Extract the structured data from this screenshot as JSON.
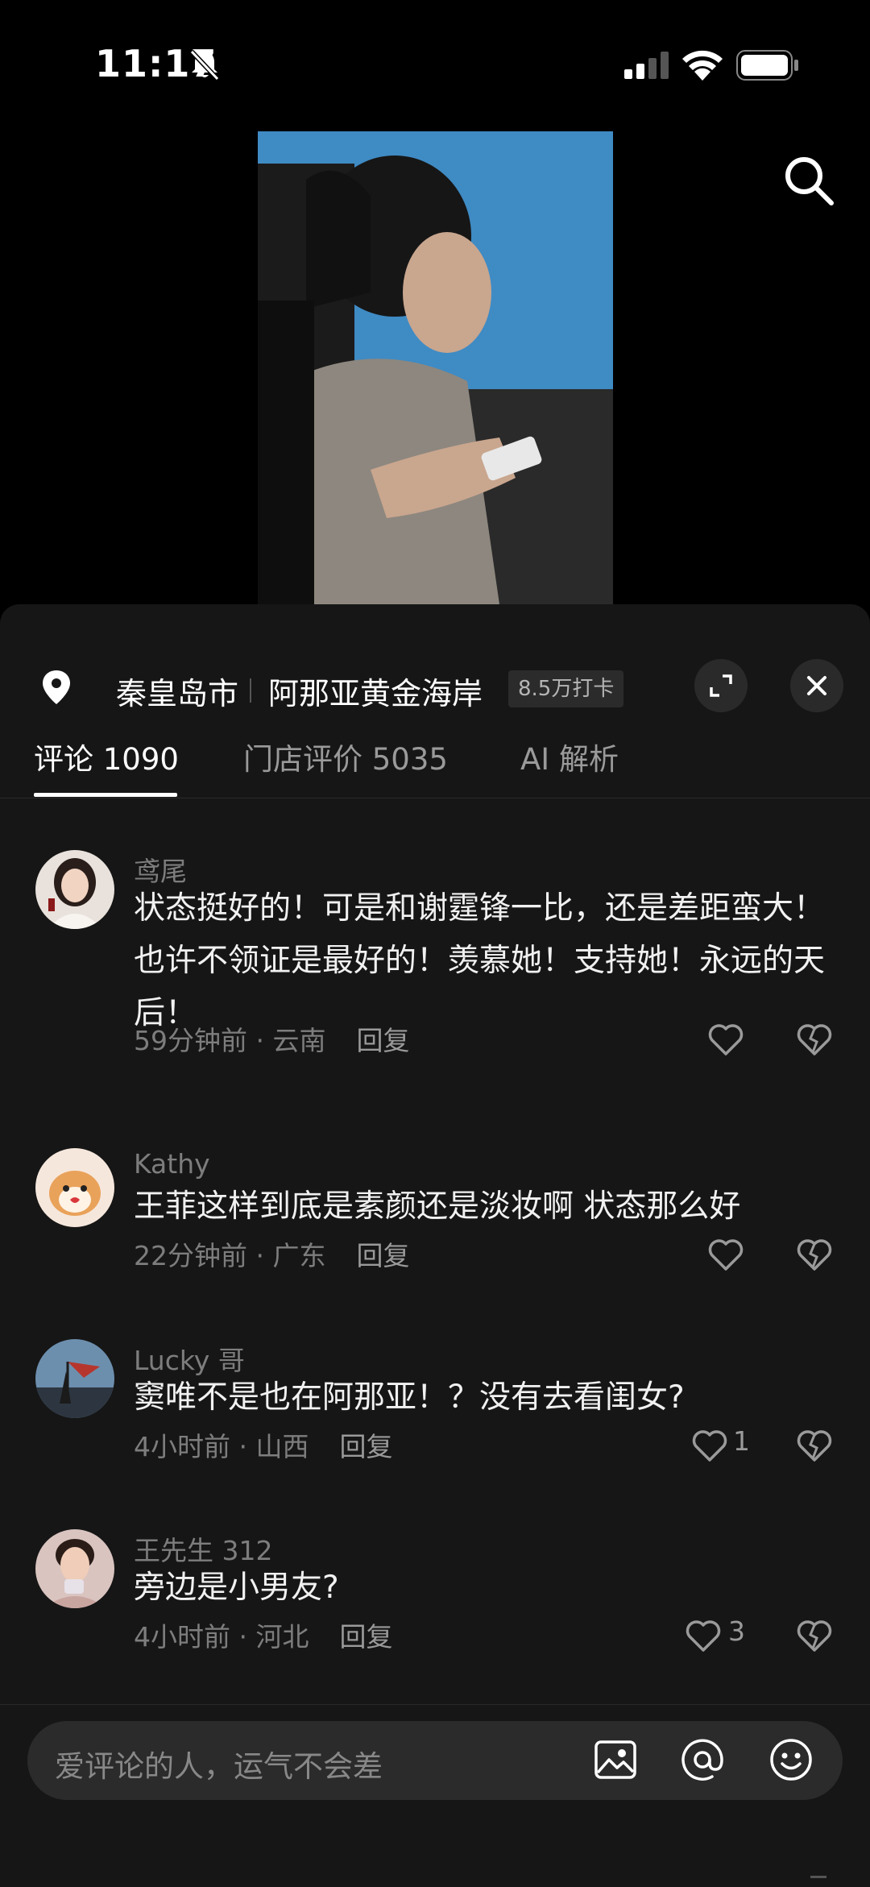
{
  "status": {
    "time": "11:17"
  },
  "location": {
    "city": "秦皇岛市",
    "place": "阿那亚黄金海岸",
    "checkins": "8.5万打卡"
  },
  "tabs": [
    {
      "label": "评论 1090"
    },
    {
      "label": "门店评价 5035"
    },
    {
      "label": "AI 解析"
    }
  ],
  "comments": [
    {
      "user": "鸢尾",
      "text": "状态挺好的！可是和谢霆锋一比，还是差距蛮大！也许不领证是最好的！羡慕她！支持她！永远的天后！",
      "meta": "59分钟前 · 云南",
      "reply": "回复",
      "likes": ""
    },
    {
      "user": "Kathy",
      "text": "王菲这样到底是素颜还是淡妆啊 状态那么好",
      "meta": "22分钟前 · 广东",
      "reply": "回复",
      "likes": ""
    },
    {
      "user": "Lucky 哥",
      "text": "窦唯不是也在阿那亚！？没有去看闺女?",
      "meta": "4小时前 · 山西",
      "reply": "回复",
      "likes": "1"
    },
    {
      "user": "王先生 312",
      "text": "旁边是小男友?",
      "meta": "4小时前 · 河北",
      "reply": "回复",
      "likes": "3"
    }
  ],
  "input": {
    "placeholder": "爱评论的人，运气不会差"
  },
  "colors": {
    "sheet_bg": "#161616",
    "accent": "#ffffff",
    "muted": "#7d7d7d"
  }
}
